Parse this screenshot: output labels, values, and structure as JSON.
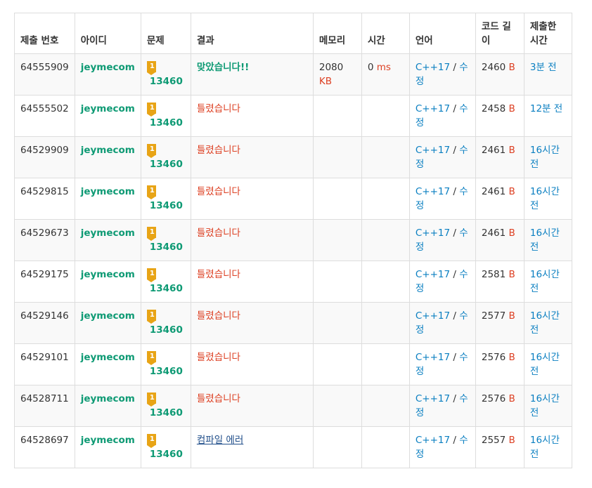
{
  "headers": {
    "submission_id": "제출 번호",
    "user_id": "아이디",
    "problem": "문제",
    "result": "결과",
    "memory": "메모리",
    "time": "시간",
    "language": "언어",
    "code_length": "코드 길이",
    "submitted_at": "제출한 시간"
  },
  "rows": [
    {
      "id": "64555909",
      "user": "jeymecom",
      "tier": "1",
      "problem": "13460",
      "result": "맞았습니다!!",
      "result_type": "ac",
      "memory": "2080",
      "memory_unit": "KB",
      "time": "0",
      "time_unit": "ms",
      "lang": "C++17",
      "edit": "수정",
      "len": "2460",
      "len_unit": "B",
      "ago": "3분 전"
    },
    {
      "id": "64555502",
      "user": "jeymecom",
      "tier": "1",
      "problem": "13460",
      "result": "틀렸습니다",
      "result_type": "wa",
      "memory": "",
      "memory_unit": "",
      "time": "",
      "time_unit": "",
      "lang": "C++17",
      "edit": "수정",
      "len": "2458",
      "len_unit": "B",
      "ago": "12분 전"
    },
    {
      "id": "64529909",
      "user": "jeymecom",
      "tier": "1",
      "problem": "13460",
      "result": "틀렸습니다",
      "result_type": "wa",
      "memory": "",
      "memory_unit": "",
      "time": "",
      "time_unit": "",
      "lang": "C++17",
      "edit": "수정",
      "len": "2461",
      "len_unit": "B",
      "ago": "16시간 전"
    },
    {
      "id": "64529815",
      "user": "jeymecom",
      "tier": "1",
      "problem": "13460",
      "result": "틀렸습니다",
      "result_type": "wa",
      "memory": "",
      "memory_unit": "",
      "time": "",
      "time_unit": "",
      "lang": "C++17",
      "edit": "수정",
      "len": "2461",
      "len_unit": "B",
      "ago": "16시간 전"
    },
    {
      "id": "64529673",
      "user": "jeymecom",
      "tier": "1",
      "problem": "13460",
      "result": "틀렸습니다",
      "result_type": "wa",
      "memory": "",
      "memory_unit": "",
      "time": "",
      "time_unit": "",
      "lang": "C++17",
      "edit": "수정",
      "len": "2461",
      "len_unit": "B",
      "ago": "16시간 전"
    },
    {
      "id": "64529175",
      "user": "jeymecom",
      "tier": "1",
      "problem": "13460",
      "result": "틀렸습니다",
      "result_type": "wa",
      "memory": "",
      "memory_unit": "",
      "time": "",
      "time_unit": "",
      "lang": "C++17",
      "edit": "수정",
      "len": "2581",
      "len_unit": "B",
      "ago": "16시간 전"
    },
    {
      "id": "64529146",
      "user": "jeymecom",
      "tier": "1",
      "problem": "13460",
      "result": "틀렸습니다",
      "result_type": "wa",
      "memory": "",
      "memory_unit": "",
      "time": "",
      "time_unit": "",
      "lang": "C++17",
      "edit": "수정",
      "len": "2577",
      "len_unit": "B",
      "ago": "16시간 전"
    },
    {
      "id": "64529101",
      "user": "jeymecom",
      "tier": "1",
      "problem": "13460",
      "result": "틀렸습니다",
      "result_type": "wa",
      "memory": "",
      "memory_unit": "",
      "time": "",
      "time_unit": "",
      "lang": "C++17",
      "edit": "수정",
      "len": "2576",
      "len_unit": "B",
      "ago": "16시간 전"
    },
    {
      "id": "64528711",
      "user": "jeymecom",
      "tier": "1",
      "problem": "13460",
      "result": "틀렸습니다",
      "result_type": "wa",
      "memory": "",
      "memory_unit": "",
      "time": "",
      "time_unit": "",
      "lang": "C++17",
      "edit": "수정",
      "len": "2576",
      "len_unit": "B",
      "ago": "16시간 전"
    },
    {
      "id": "64528697",
      "user": "jeymecom",
      "tier": "1",
      "problem": "13460",
      "result": "컴파일 에러",
      "result_type": "ce",
      "memory": "",
      "memory_unit": "",
      "time": "",
      "time_unit": "",
      "lang": "C++17",
      "edit": "수정",
      "len": "2557",
      "len_unit": "B",
      "ago": "16시간 전"
    }
  ],
  "colors": {
    "accepted": "#0e9a74",
    "wrong": "#dd4124",
    "compile_error": "#204e8a",
    "link": "#0a7fc1",
    "tier_badge": "#e8a416"
  },
  "icons": {
    "tier": "tier-badge-icon"
  }
}
